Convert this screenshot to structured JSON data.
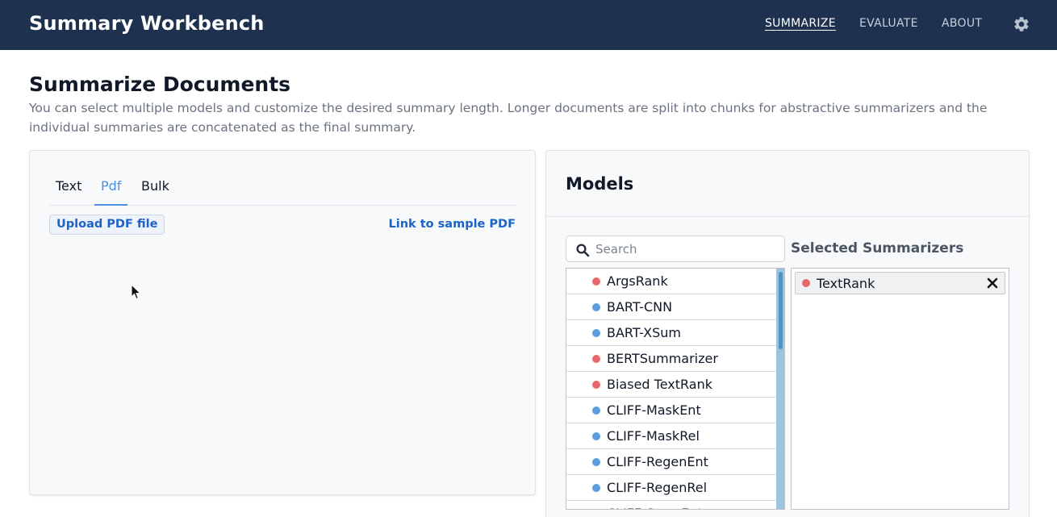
{
  "app": {
    "title": "Summary Workbench",
    "nav": [
      {
        "label": "SUMMARIZE",
        "active": true
      },
      {
        "label": "EVALUATE",
        "active": false
      },
      {
        "label": "ABOUT",
        "active": false
      }
    ],
    "settings_icon": "gear-icon"
  },
  "page": {
    "title": "Summarize Documents",
    "description": "You can select multiple models and customize the desired summary length. Longer documents are split into chunks for abstractive summarizers and the individual summaries are concatenated as the final summary."
  },
  "input_panel": {
    "tabs": [
      {
        "label": "Text",
        "active": false
      },
      {
        "label": "Pdf",
        "active": true
      },
      {
        "label": "Bulk",
        "active": false
      }
    ],
    "upload_label": "Upload PDF file",
    "sample_link": "Link to sample PDF"
  },
  "models_panel": {
    "title": "Models",
    "search_placeholder": "Search",
    "search_value": "",
    "selected_title": "Selected Summarizers",
    "colors": {
      "extractive": "#e8696b",
      "abstractive": "#5b9be0"
    },
    "models": [
      {
        "label": "ArgsRank",
        "kind": "extractive"
      },
      {
        "label": "BART-CNN",
        "kind": "abstractive"
      },
      {
        "label": "BART-XSum",
        "kind": "abstractive"
      },
      {
        "label": "BERTSummarizer",
        "kind": "extractive"
      },
      {
        "label": "Biased TextRank",
        "kind": "extractive"
      },
      {
        "label": "CLIFF-MaskEnt",
        "kind": "abstractive"
      },
      {
        "label": "CLIFF-MaskRel",
        "kind": "abstractive"
      },
      {
        "label": "CLIFF-RegenEnt",
        "kind": "abstractive"
      },
      {
        "label": "CLIFF-RegenRel",
        "kind": "abstractive"
      },
      {
        "label": "CLIFF-SwapEnt",
        "kind": "abstractive"
      }
    ],
    "scroll_position": 0.0,
    "selected": [
      {
        "label": "TextRank",
        "kind": "extractive"
      }
    ]
  }
}
